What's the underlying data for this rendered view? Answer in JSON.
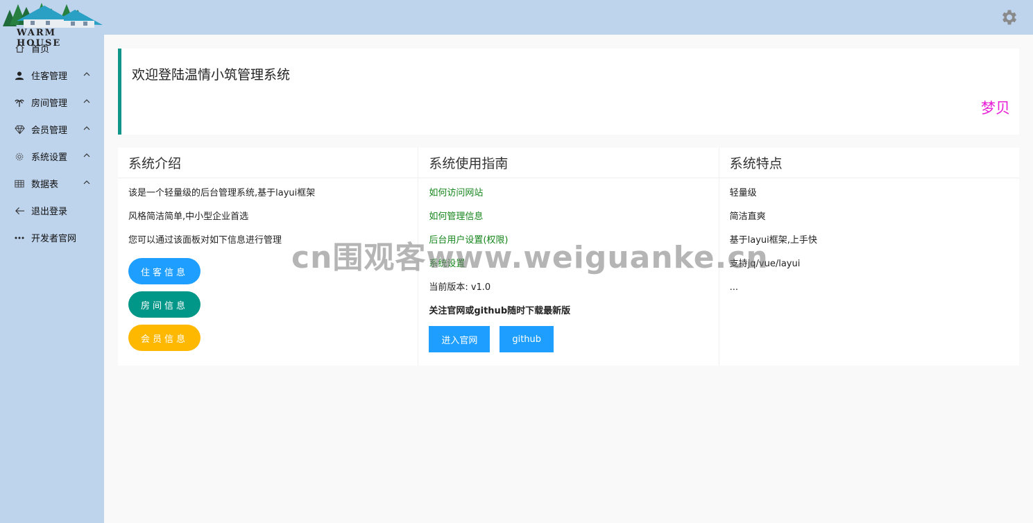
{
  "brand": {
    "logo_text": "WARM HOUSE"
  },
  "sidebar": {
    "items": [
      {
        "label": "首页",
        "icon": "home-icon",
        "expandable": false
      },
      {
        "label": "住客管理",
        "icon": "user-icon",
        "expandable": true
      },
      {
        "label": "房间管理",
        "icon": "palm-icon",
        "expandable": true
      },
      {
        "label": "会员管理",
        "icon": "diamond-icon",
        "expandable": true
      },
      {
        "label": "系统设置",
        "icon": "gear-icon",
        "expandable": true
      },
      {
        "label": "数据表",
        "icon": "table-icon",
        "expandable": true
      },
      {
        "label": "退出登录",
        "icon": "arrow-left-icon",
        "expandable": false
      },
      {
        "label": "开发者官网",
        "icon": "more-icon",
        "expandable": false
      }
    ]
  },
  "header": {
    "settings_icon": "gear-icon"
  },
  "welcome": {
    "title": "欢迎登陆温情小筑管理系统",
    "marquee": "梦贝",
    "accent_color": "#0f9688",
    "marquee_color": "#e61fd6"
  },
  "panels": {
    "intro": {
      "title": "系统介绍",
      "lines": [
        "该是一个轻量级的后台管理系统,基于layui框架",
        "风格简洁简单,中小型企业首选",
        "您可以通过该面板对如下信息进行管理"
      ],
      "buttons": [
        "住客信息",
        "房间信息",
        "会员信息"
      ]
    },
    "guide": {
      "title": "系统使用指南",
      "links": [
        "如何访问网站",
        "如何管理信息",
        "后台用户设置(权限)",
        "系统设置"
      ],
      "version": "当前版本: v1.0",
      "notice": "关注官网或github随时下载最新版",
      "buttons": [
        "进入官网",
        "github"
      ]
    },
    "features": {
      "title": "系统特点",
      "lines": [
        "轻量级",
        "简洁直爽",
        "基于layui框架,上手快",
        "支持jq/vue/layui",
        "..."
      ]
    }
  },
  "watermark": "cn围观客www.weiguanke.cn",
  "colors": {
    "sidebar_bg": "#bed3ec",
    "blue": "#1e9fff",
    "green": "#009688",
    "yellow": "#ffb800",
    "link": "#15851b"
  }
}
